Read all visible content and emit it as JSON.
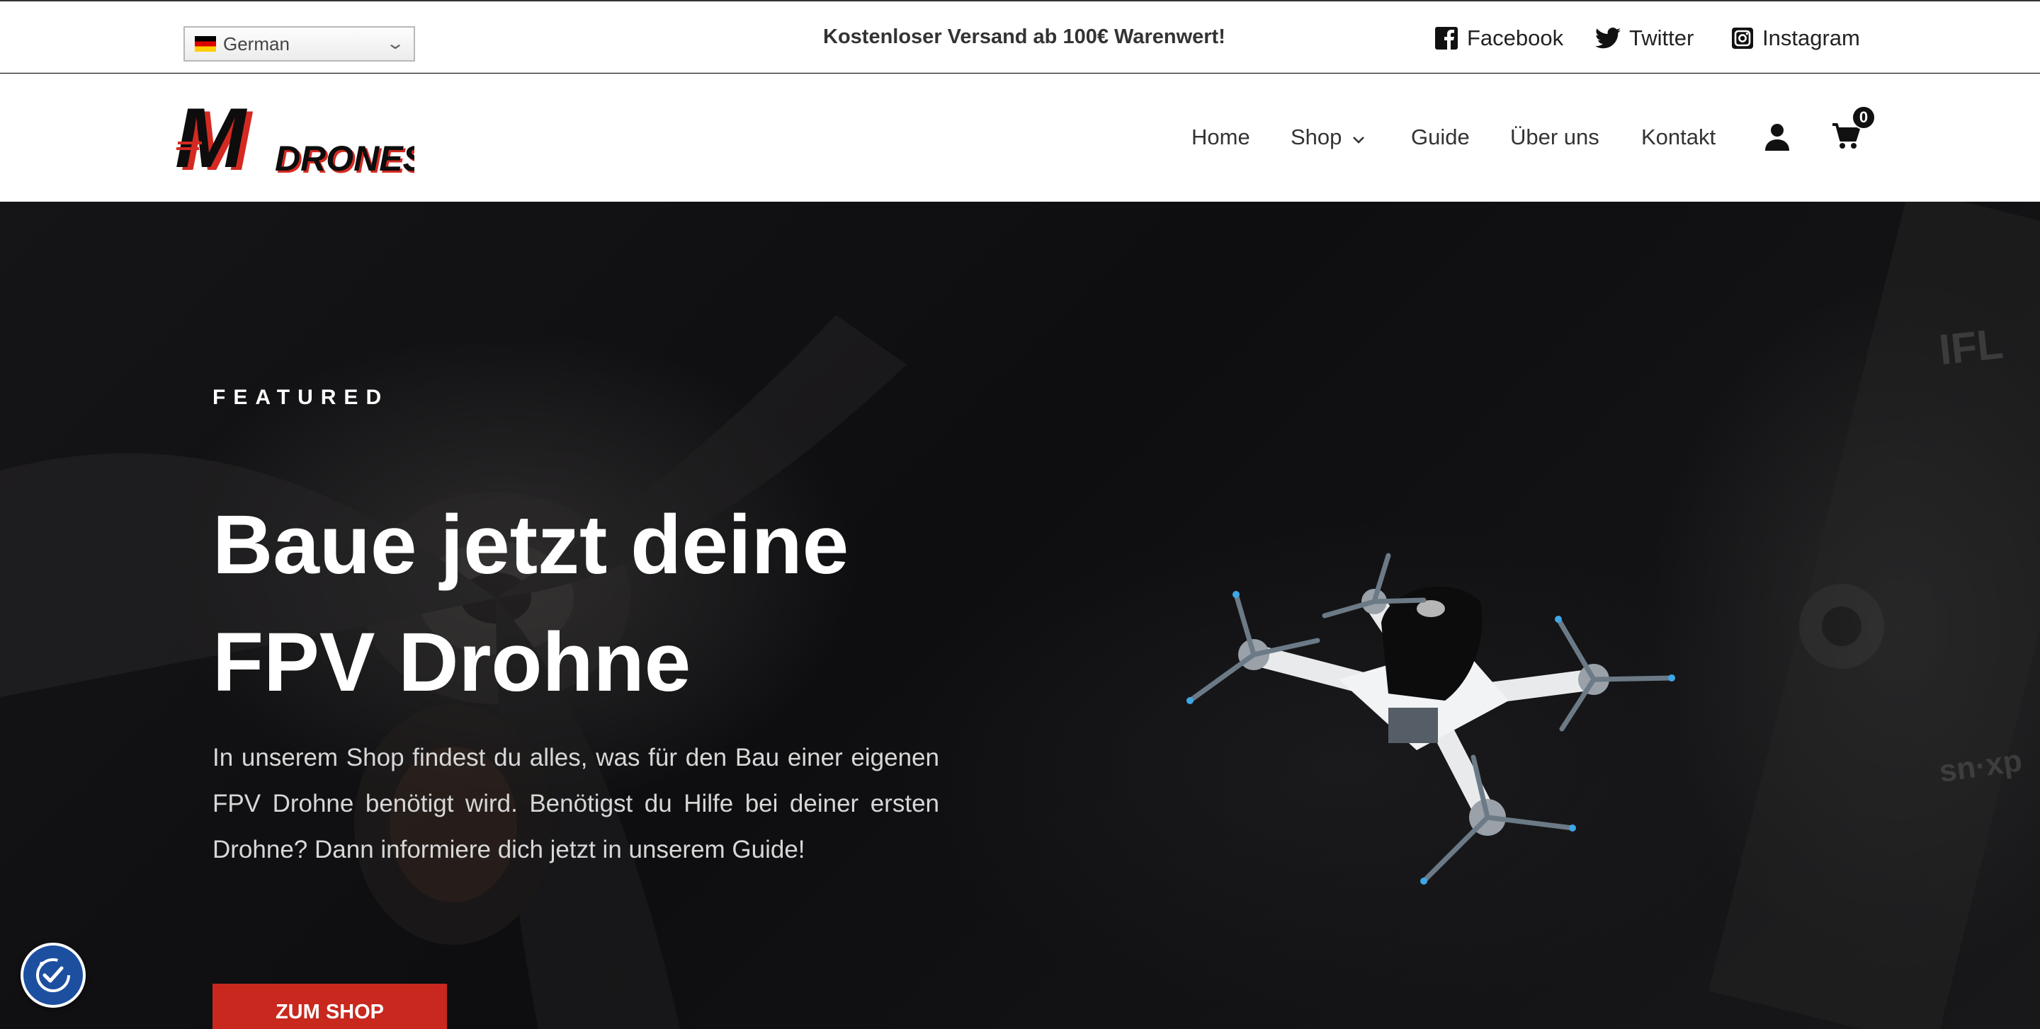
{
  "topbar": {
    "language": {
      "selected": "German"
    },
    "promo": "Kostenloser Versand ab 100€ Warenwert!",
    "social": [
      {
        "label": "Facebook",
        "icon": "facebook-icon"
      },
      {
        "label": "Twitter",
        "icon": "twitter-icon"
      },
      {
        "label": "Instagram",
        "icon": "instagram-icon"
      }
    ]
  },
  "header": {
    "logo": {
      "letter": "M",
      "word": "DRONES"
    },
    "nav": [
      {
        "label": "Home"
      },
      {
        "label": "Shop",
        "has_dropdown": true
      },
      {
        "label": "Guide"
      },
      {
        "label": "Über uns"
      },
      {
        "label": "Kontakt"
      }
    ],
    "cart_count": "0"
  },
  "hero": {
    "eyebrow": "FEATURED",
    "title_line1": "Baue jetzt deine",
    "title_line2": "FPV Drohne",
    "text": "In unserem Shop findest du alles, was für den Bau einer eigenen FPV Drohne benötigt wird. Benötigst du Hilfe bei deiner ersten Drohne? Dann informiere dich jetzt in unserem Guide!",
    "cta_label": "ZUM SHOP"
  },
  "colors": {
    "accent": "#c8281e",
    "accessibility_button": "#1d4fa0",
    "hero_background": "#111113"
  }
}
